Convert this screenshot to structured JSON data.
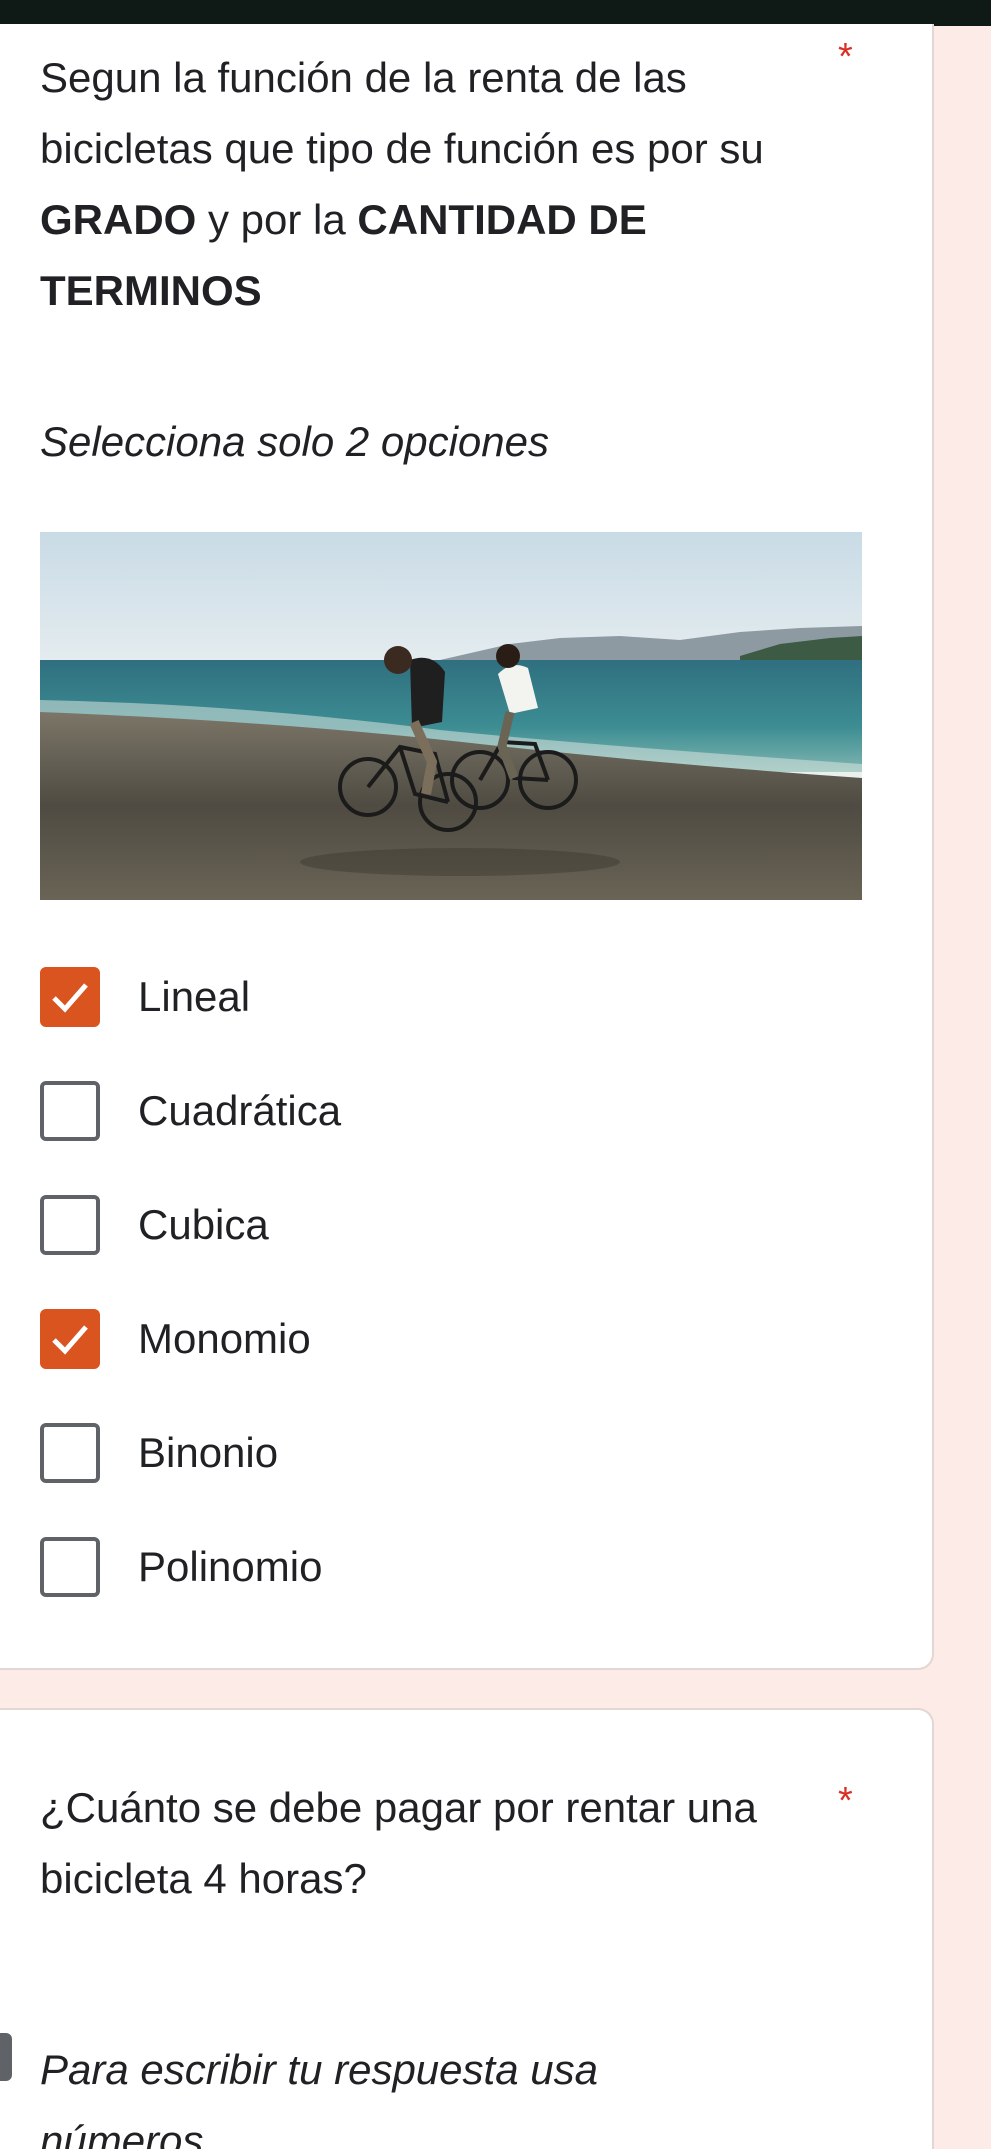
{
  "question1": {
    "title_parts": [
      {
        "text": "Segun la función de la renta de las bicicletas que  tipo de función es por su ",
        "bold": false
      },
      {
        "text": "GRADO",
        "bold": true
      },
      {
        "text": " y por la ",
        "bold": false
      },
      {
        "text": "CANTIDAD DE TERMINOS",
        "bold": true
      }
    ],
    "required_mark": "*",
    "description": "Selecciona solo 2 opciones",
    "options": [
      {
        "label": "Lineal",
        "checked": true
      },
      {
        "label": "Cuadrática",
        "checked": false
      },
      {
        "label": "Cubica",
        "checked": false
      },
      {
        "label": "Monomio",
        "checked": true
      },
      {
        "label": "Binonio",
        "checked": false
      },
      {
        "label": "Polinomio",
        "checked": false
      }
    ]
  },
  "question2": {
    "title": "¿Cuánto se debe pagar por rentar una bicicleta 4 horas?",
    "required_mark": "*",
    "description": "Para escribir tu respuesta usa números"
  },
  "colors": {
    "accent": "#d9541f",
    "required": "#d93025",
    "background": "#fcebe6"
  }
}
